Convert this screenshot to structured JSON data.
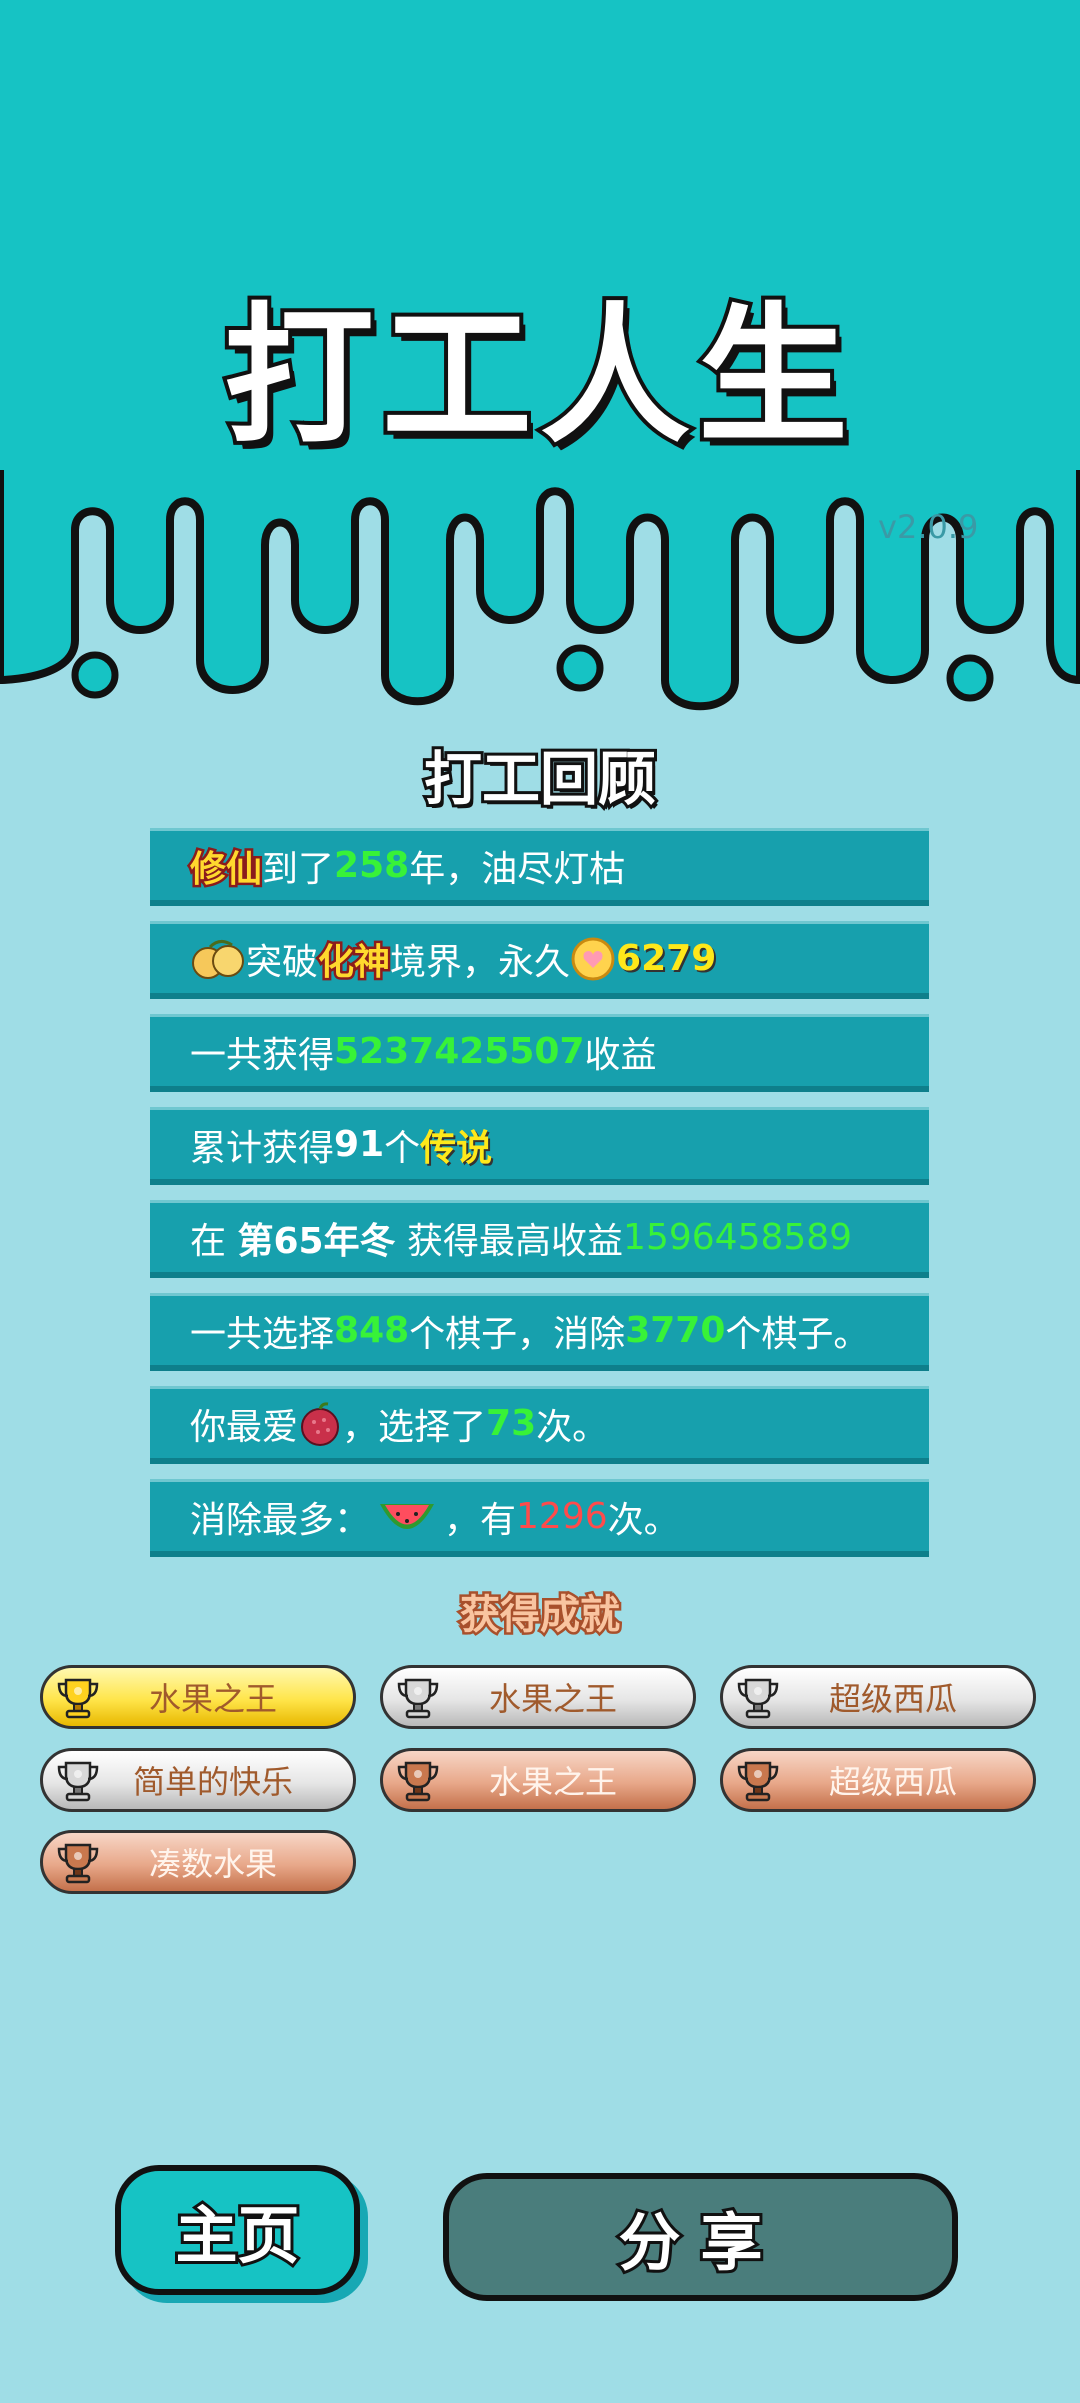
{
  "header": {
    "title": "打工人生",
    "version": "v2.0.9"
  },
  "review": {
    "title": "打工回顾",
    "row1": {
      "tag": "修仙",
      "t1": "到了",
      "years": "258",
      "t2": "年，油尽灯枯"
    },
    "row2": {
      "t1": "突破",
      "realm": "化神",
      "t2": "境界，永久",
      "value": "6279"
    },
    "row3": {
      "t1": "一共获得",
      "value": "5237425507",
      "t2": "收益"
    },
    "row4": {
      "t1": "累计获得",
      "count": "91",
      "t2": "个",
      "rarity": "传说"
    },
    "row5": {
      "t1": "在",
      "period": "第65年冬",
      "t2": "获得最高收益",
      "value": "1596458589"
    },
    "row6": {
      "t1": "一共选择",
      "selected": "848",
      "t2": "个棋子，消除",
      "removed": "3770",
      "t3": "个棋子。"
    },
    "row7": {
      "t1": "你最爱",
      "t2": "，选择了",
      "count": "73",
      "t3": "次。"
    },
    "row8": {
      "t1": "消除最多：",
      "t2": "，有",
      "count": "1296",
      "t3": "次。"
    }
  },
  "achievements": {
    "title": "获得成就",
    "items": [
      {
        "label": "水果之王",
        "tier": "gold"
      },
      {
        "label": "水果之王",
        "tier": "silver"
      },
      {
        "label": "超级西瓜",
        "tier": "silver"
      },
      {
        "label": "简单的快乐",
        "tier": "silver"
      },
      {
        "label": "水果之王",
        "tier": "bronze"
      },
      {
        "label": "超级西瓜",
        "tier": "bronze"
      },
      {
        "label": "凑数水果",
        "tier": "bronze"
      }
    ]
  },
  "buttons": {
    "home": "主页",
    "share": "分享"
  },
  "icons": {
    "peach": "peach-icon",
    "coin": "coin-icon",
    "lychee": "lychee-icon",
    "watermelon": "watermelon-icon",
    "trophy": "trophy-icon"
  },
  "colors": {
    "sky": "#16c3c4",
    "background": "#9fdde6",
    "row": "#17a0ad",
    "highlight_green": "#38f238",
    "highlight_red": "#ff4b4b",
    "highlight_yellow": "#ffe81a"
  }
}
